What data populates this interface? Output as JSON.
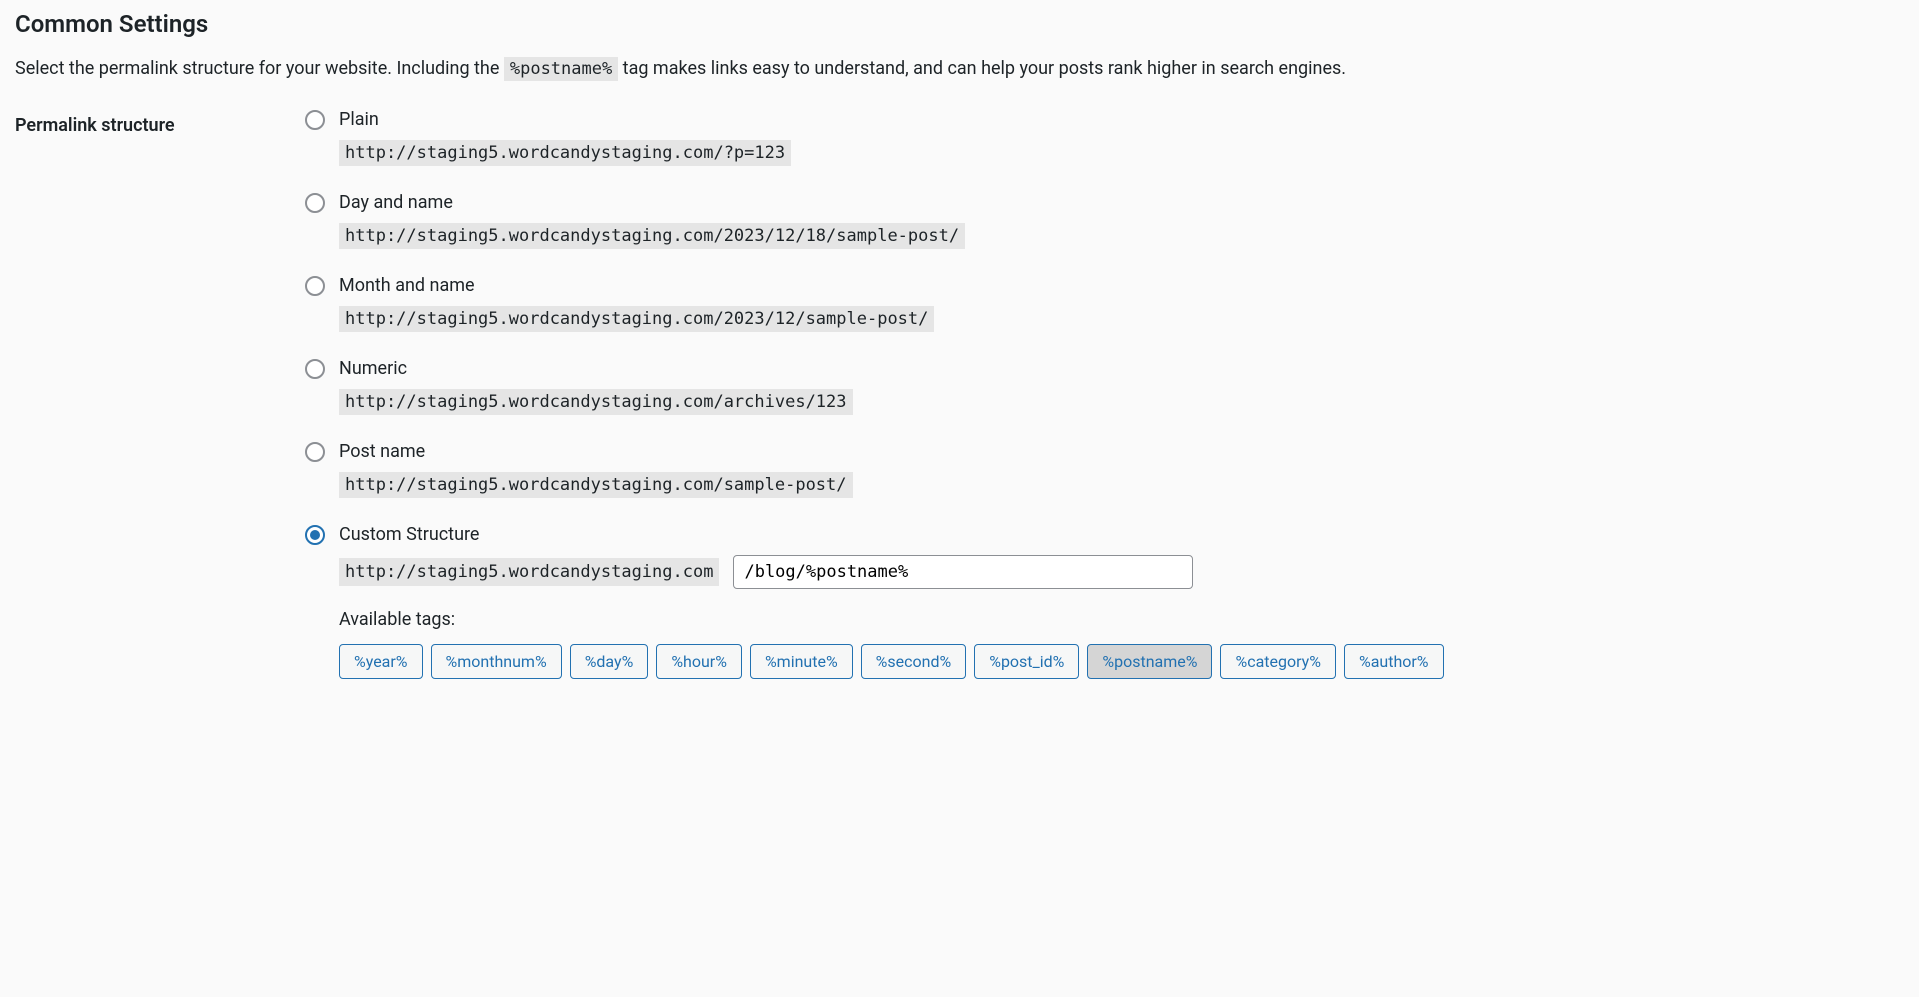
{
  "heading": "Common Settings",
  "description": {
    "prefix": "Select the permalink structure for your website. Including the ",
    "tag_code": "%postname%",
    "suffix": " tag makes links easy to understand, and can help your posts rank higher in search engines."
  },
  "permalink_label": "Permalink structure",
  "options": {
    "plain": {
      "label": "Plain",
      "url": "http://staging5.wordcandystaging.com/?p=123"
    },
    "day_name": {
      "label": "Day and name",
      "url": "http://staging5.wordcandystaging.com/2023/12/18/sample-post/"
    },
    "month_name": {
      "label": "Month and name",
      "url": "http://staging5.wordcandystaging.com/2023/12/sample-post/"
    },
    "numeric": {
      "label": "Numeric",
      "url": "http://staging5.wordcandystaging.com/archives/123"
    },
    "post_name": {
      "label": "Post name",
      "url": "http://staging5.wordcandystaging.com/sample-post/"
    },
    "custom": {
      "label": "Custom Structure",
      "prefix": "http://staging5.wordcandystaging.com",
      "value": "/blog/%postname%"
    }
  },
  "available_tags_label": "Available tags:",
  "tags": [
    "%year%",
    "%monthnum%",
    "%day%",
    "%hour%",
    "%minute%",
    "%second%",
    "%post_id%",
    "%postname%",
    "%category%",
    "%author%"
  ]
}
